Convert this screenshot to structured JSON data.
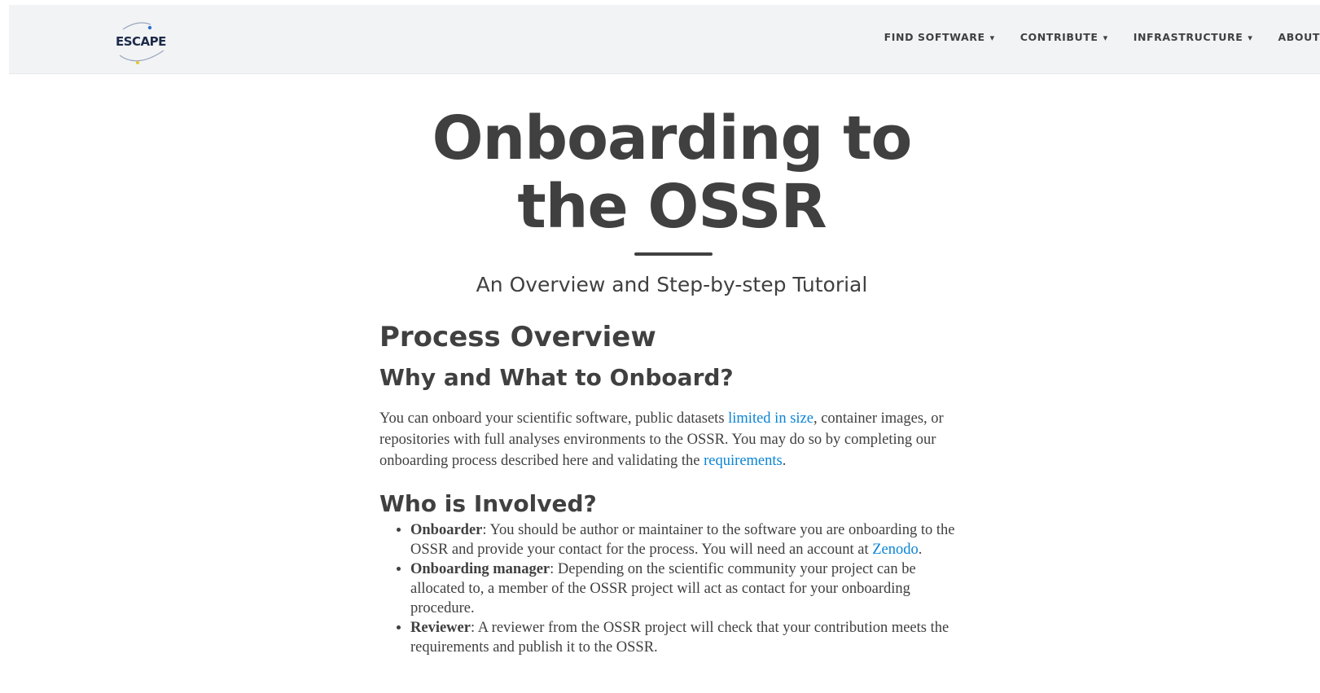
{
  "nav": {
    "logo_text": "ESCAPE",
    "items": [
      {
        "label": "FIND SOFTWARE",
        "caret": "▾"
      },
      {
        "label": "CONTRIBUTE",
        "caret": "▾"
      },
      {
        "label": "INFRASTRUCTURE",
        "caret": "▾"
      },
      {
        "label": "ABOUT",
        "caret": ""
      }
    ]
  },
  "hero": {
    "title_line1": "Onboarding to",
    "title_line2": "the OSSR",
    "subtitle": "An Overview and Step-by-step Tutorial"
  },
  "content": {
    "h2": "Process Overview",
    "why": {
      "heading": "Why and What to Onboard?",
      "text1": "You can onboard your scientific software, public datasets ",
      "link1": "limited in size",
      "text2": ", container images, or repositories with full analyses environments to the OSSR. You may do so by completing our onboarding process described here and validating the ",
      "link2": "requirements",
      "text3": "."
    },
    "who": {
      "heading": "Who is Involved?",
      "items": [
        {
          "term": "Onboarder",
          "text": ": You should be author or maintainer to the software you are onboarding to the OSSR and provide your contact for the process. You will need an account at ",
          "link": "Zenodo",
          "after": "."
        },
        {
          "term": "Onboarding manager",
          "text": ": Depending on the scientific community your project can be allocated to, a member of the OSSR project will act as contact for your onboarding procedure."
        },
        {
          "term": "Reviewer",
          "text": ": A reviewer from the OSSR project will check that your contribution meets the requirements and publish it to the OSSR."
        }
      ]
    }
  },
  "colors": {
    "text": "#404040",
    "link": "#0a84d6",
    "navbar_bg": "#f2f3f5"
  }
}
